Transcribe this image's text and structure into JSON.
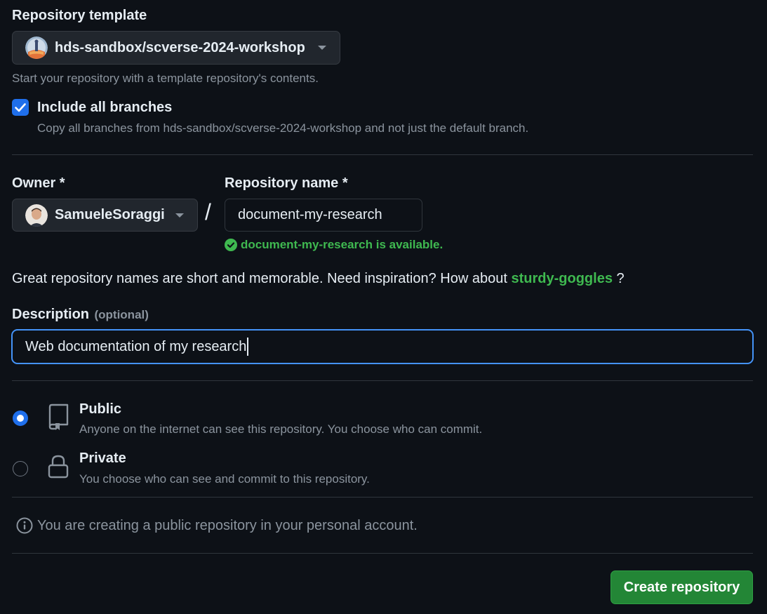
{
  "template": {
    "label": "Repository template",
    "selected": "hds-sandbox/scverse-2024-workshop",
    "help": "Start your repository with a template repository's contents."
  },
  "branches": {
    "checked": true,
    "label": "Include all branches",
    "help": "Copy all branches from hds-sandbox/scverse-2024-workshop and not just the default branch."
  },
  "owner": {
    "label": "Owner *",
    "selected": "SamueleSoraggi"
  },
  "separator": "/",
  "repo_name": {
    "label": "Repository name *",
    "value": "document-my-research",
    "availability": "document-my-research is available."
  },
  "suggestion": {
    "prefix": "Great repository names are short and memorable. Need inspiration? How about",
    "name": "sturdy-goggles",
    "suffix": "?"
  },
  "description": {
    "label": "Description",
    "optional": "(optional)",
    "value": "Web documentation of my research"
  },
  "visibility": {
    "options": [
      {
        "title": "Public",
        "help": "Anyone on the internet can see this repository. You choose who can commit.",
        "selected": true
      },
      {
        "title": "Private",
        "help": "You choose who can see and commit to this repository.",
        "selected": false
      }
    ]
  },
  "notice": "You are creating a public repository in your personal account.",
  "create_button": "Create repository",
  "colors": {
    "background": "#0d1117",
    "accent_blue": "#1f6feb",
    "success_green": "#3fb950",
    "button_green": "#238636"
  },
  "icons": {
    "public": "repo-icon",
    "private": "lock-icon",
    "info": "info-icon",
    "check": "check-circle-icon"
  }
}
